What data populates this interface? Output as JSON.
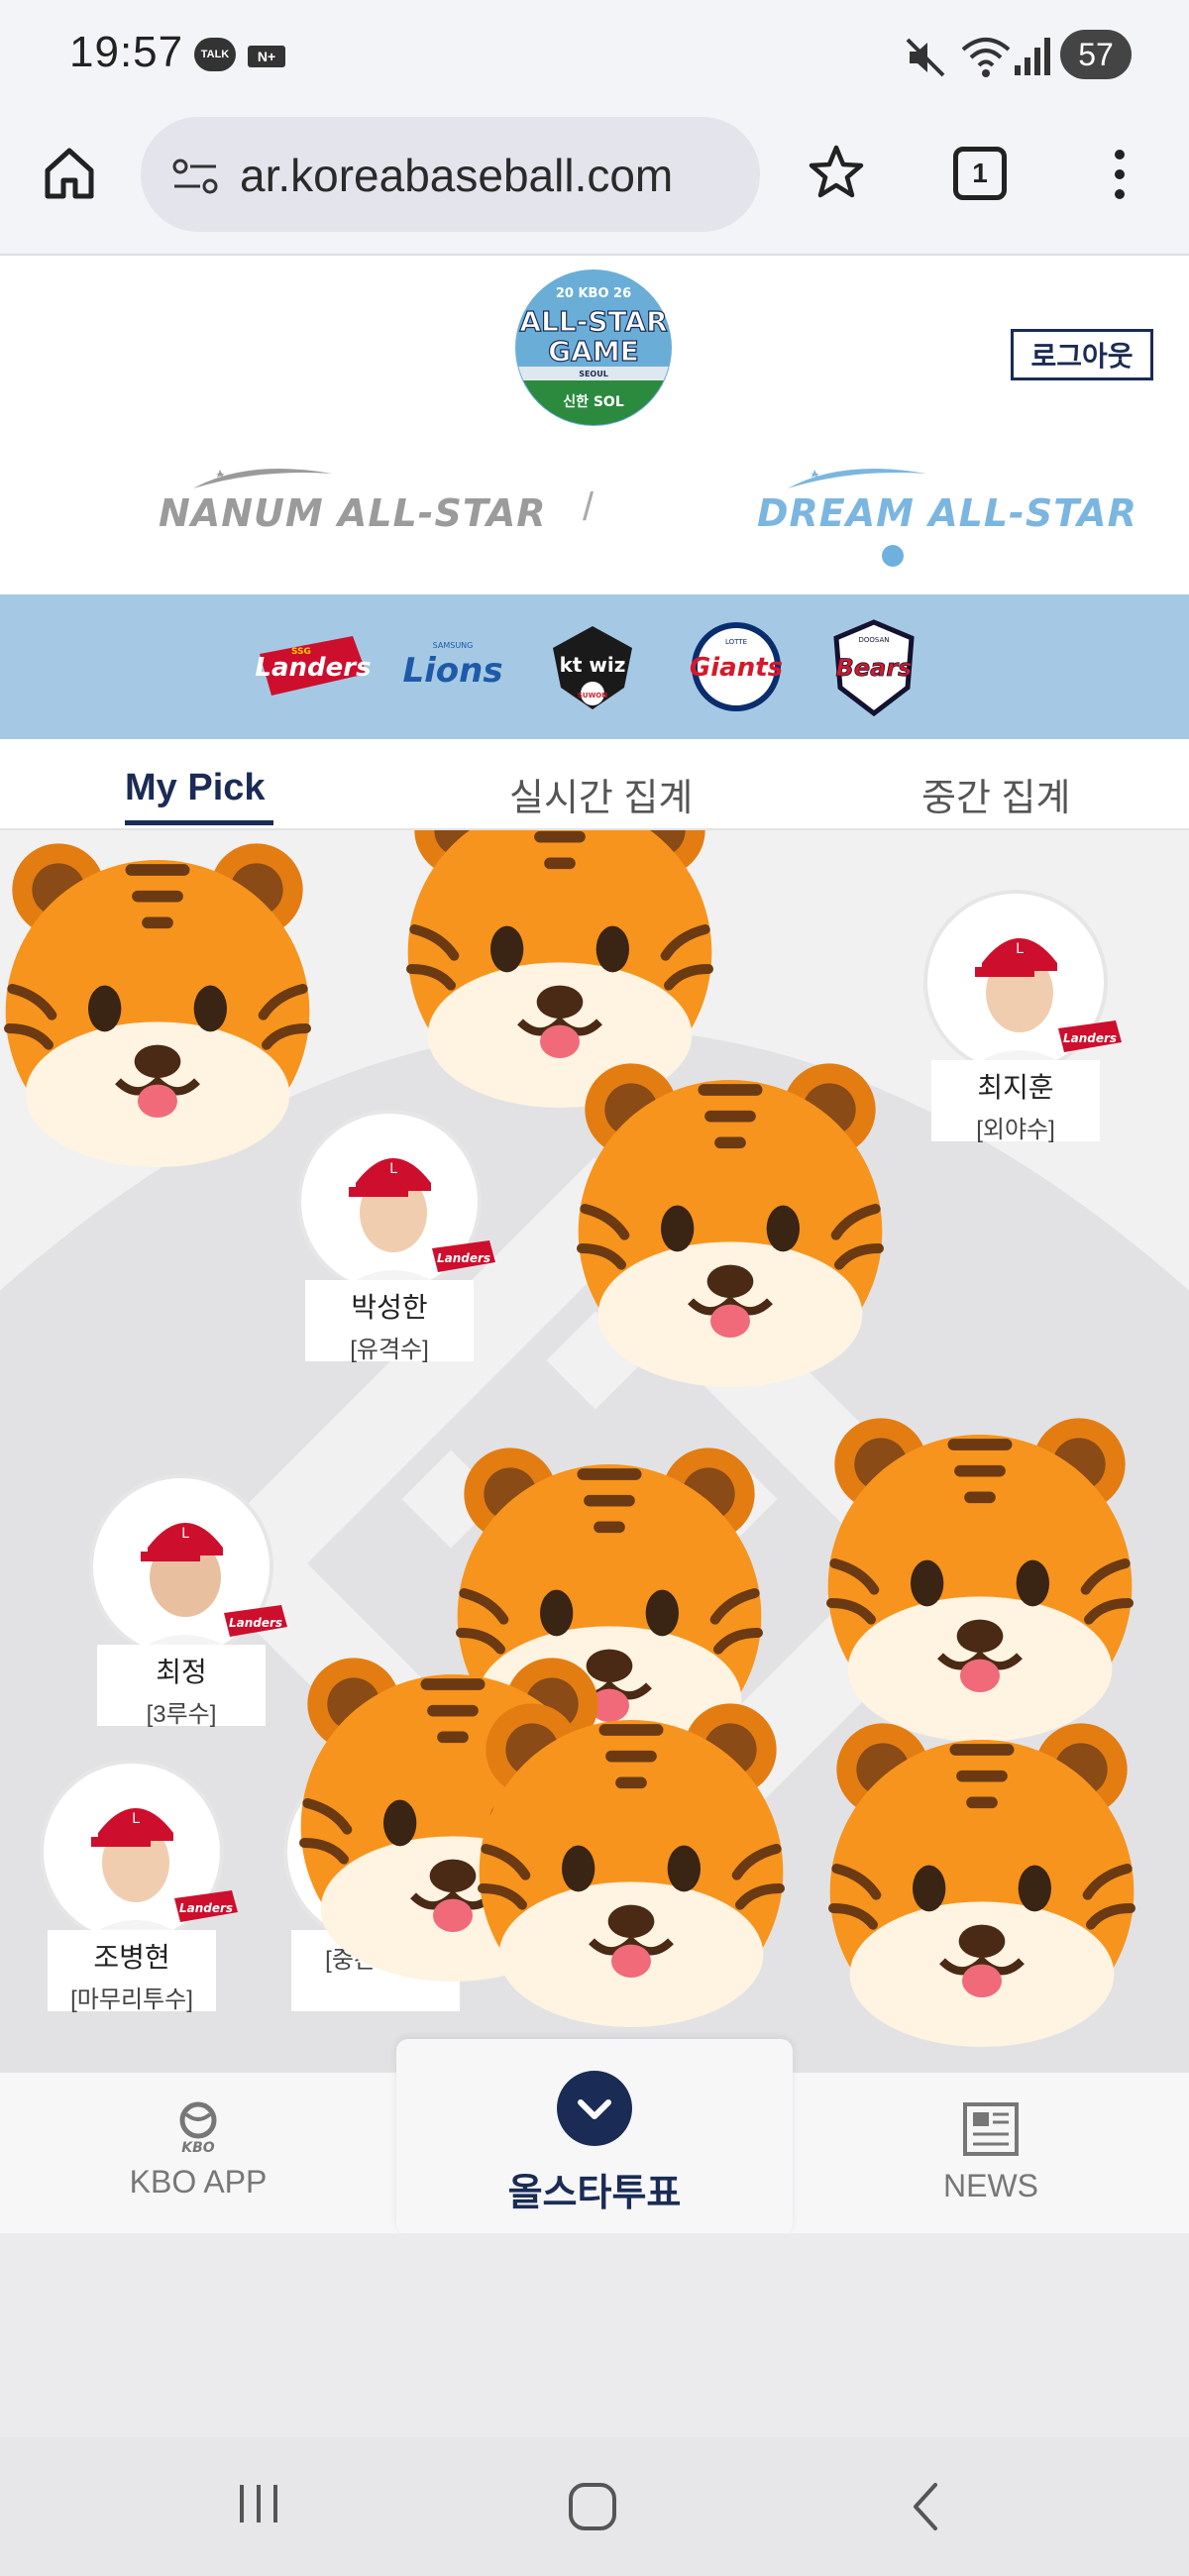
{
  "status_bar": {
    "time": "19:57",
    "talk_badge": "TALK",
    "nplus_badge": "N+",
    "battery": "57"
  },
  "browser": {
    "url": "ar.koreabaseball.com",
    "tab_count": "1"
  },
  "header": {
    "logo": {
      "line1": "20 KBO 26",
      "line2": "ALL-STAR",
      "line3": "GAME",
      "line4": "SEOUL",
      "sponsor": "신한 SOL"
    },
    "logout_label": "로그아웃",
    "nanum_label": "NANUM ALL-STAR",
    "separator": "/",
    "dream_label": "DREAM ALL-STAR"
  },
  "teams": [
    {
      "name": "Landers",
      "sub": "SSG"
    },
    {
      "name": "Lions",
      "sub": "SAMSUNG"
    },
    {
      "name": "kt wiz",
      "sub": "SUWON"
    },
    {
      "name": "Giants",
      "sub": "LOTTE"
    },
    {
      "name": "Bears",
      "sub": "DOOSAN"
    }
  ],
  "tabs": {
    "my_pick": "My Pick",
    "realtime": "실시간 집계",
    "interim": "중간 집계"
  },
  "players": [
    {
      "name": "최지훈",
      "position": "[외야수]",
      "team_badge": "Landers"
    },
    {
      "name": "박성한",
      "position": "[유격수]",
      "team_badge": "Landers"
    },
    {
      "name": "최정",
      "position": "[3루수]",
      "team_badge": "Landers"
    },
    {
      "name": "조병현",
      "position": "[마무리투수]",
      "team_badge": "Landers"
    },
    {
      "name": "",
      "position": "[중간투수]",
      "team_badge": ""
    }
  ],
  "bottom_nav": {
    "kbo_app_label": "KBO APP",
    "kbo_icon_text": "KBO",
    "vote_label": "올스타투표",
    "news_label": "NEWS"
  },
  "colors": {
    "navy": "#1b2b55",
    "team_bar": "#a5c9e4",
    "landers_red": "#ce0e2d",
    "tiger_orange": "#f7941d"
  },
  "icons": [
    "home-icon",
    "site-settings-icon",
    "star-icon",
    "tab-switcher-icon",
    "more-vert-icon",
    "chevron-down-icon",
    "news-icon",
    "kbo-logo-icon",
    "mute-icon",
    "wifi-icon",
    "signal-icon",
    "tiger-emoji-icon"
  ]
}
